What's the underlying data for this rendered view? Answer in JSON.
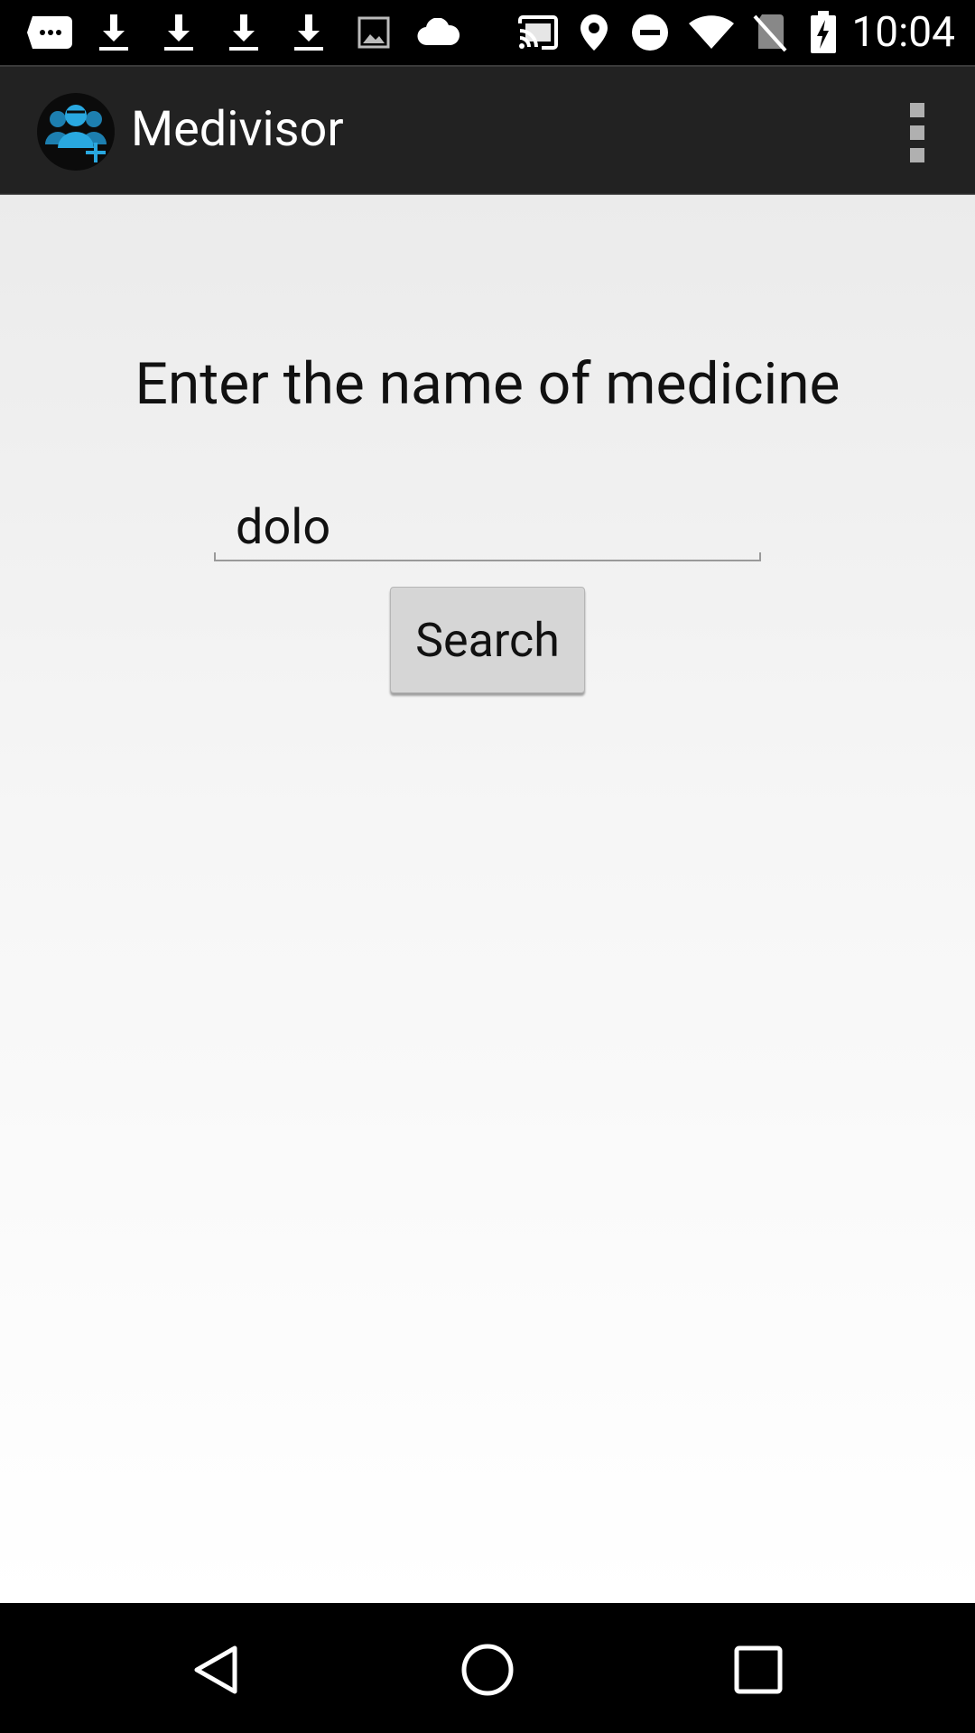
{
  "status_bar": {
    "time": "10:04",
    "icons": [
      "message-icon",
      "download-icon",
      "download-icon",
      "download-icon",
      "download-icon",
      "image-icon",
      "cloud-icon",
      "cast-icon",
      "location-icon",
      "do-not-disturb-icon",
      "wifi-icon",
      "no-sim-icon",
      "battery-charging-icon"
    ]
  },
  "action_bar": {
    "title": "Medivisor",
    "logo_icon": "medivisor-logo-icon",
    "menu_icon": "overflow-menu-icon"
  },
  "main": {
    "prompt": "Enter the name of medicine",
    "search_input": {
      "value": "dolo",
      "placeholder": ""
    },
    "search_button": "Search"
  },
  "nav_bar": {
    "icons": [
      "back-icon",
      "home-icon",
      "recents-icon"
    ]
  },
  "colors": {
    "accent": "#29a8e0",
    "action_bar_bg": "#222222",
    "button_bg": "#d6d6d6"
  }
}
